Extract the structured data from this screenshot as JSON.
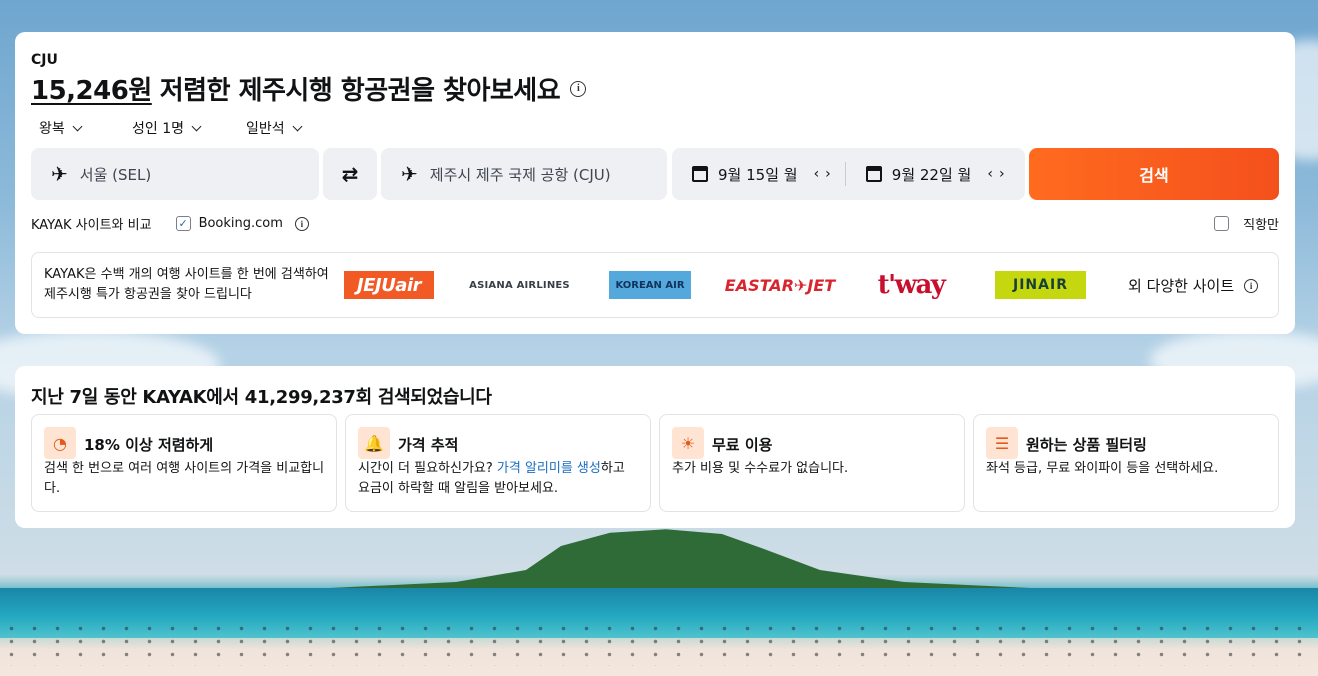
{
  "header": {
    "airport_code": "CJU",
    "price": "15,246원",
    "headline_rest": "저렴한 제주시행 항공권을 찾아보세요"
  },
  "trip_options": {
    "trip_type": "왕복",
    "passengers": "성인 1명",
    "cabin_class": "일반석"
  },
  "search_form": {
    "origin": "서울 (SEL)",
    "destination": "제주시 제주 국제 공항 (CJU)",
    "depart_date": "9월 15일 월",
    "return_date": "9월 22일 월",
    "search_label": "검색"
  },
  "compare": {
    "label": "KAYAK 사이트와 비교",
    "booking_label": "Booking.com",
    "booking_checked": true,
    "direct_only_label": "직항만",
    "direct_only_checked": false
  },
  "airlines": {
    "description": "KAYAK은 수백 개의 여행 사이트를 한 번에 검색하여 제주시행 특가 항공권을 찾아 드립니다",
    "logos": [
      "JEJUair",
      "ASIANA AIRLINES",
      "KOREAN AIR",
      "EASTAR✈JET",
      "t'way",
      "JINAIR"
    ],
    "more_label": "외 다양한 사이트"
  },
  "stats": {
    "title_prefix": "지난 7일 동안 KAYAK에서 ",
    "search_count": "41,299,237",
    "title_suffix": "회 검색되었습니다"
  },
  "features": [
    {
      "icon": "piggy-bank-icon",
      "title": "18% 이상 저렴하게",
      "desc": "검색 한 번으로 여러 여행 사이트의 가격을 비교합니다."
    },
    {
      "icon": "bell-icon",
      "title": "가격 추적",
      "desc_before": "시간이 더 필요하신가요? ",
      "desc_link": "가격 알리미를 생성",
      "desc_after": "하고 요금이 하락할 때 알림을 받아보세요."
    },
    {
      "icon": "lightbulb-icon",
      "title": "무료 이용",
      "desc": "추가 비용 및 수수료가 없습니다."
    },
    {
      "icon": "filter-sliders-icon",
      "title": "원하는 상품 필터링",
      "desc": "좌석 등급, 무료 와이파이 등을 선택하세요."
    }
  ],
  "colors": {
    "accent_orange": "#ff6b1f",
    "link_blue": "#1a6fc2",
    "feature_icon_bg": "#ffe3d3"
  }
}
